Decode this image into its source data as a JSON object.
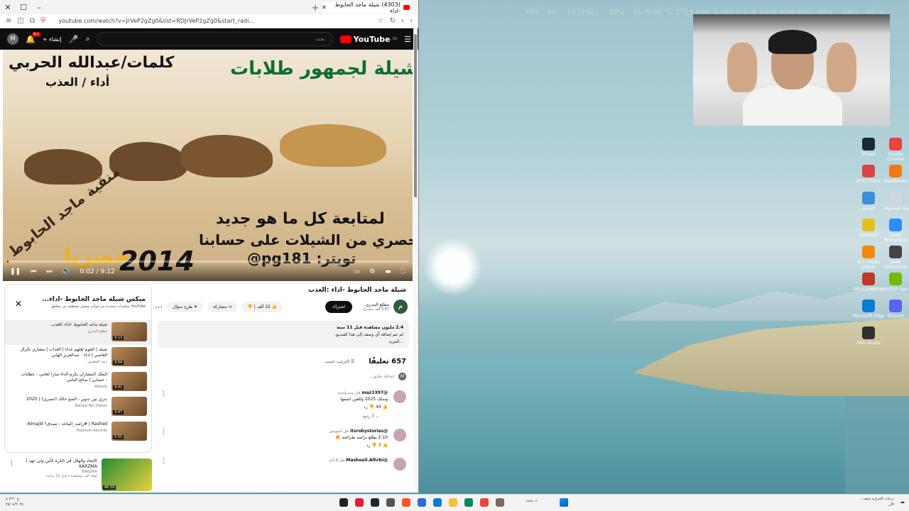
{
  "osd": {
    "fps_label": "FPS",
    "fps": "61",
    "lows": "18 (1%L)",
    "gpu_label": "GPU",
    "gpu": "91 % 66 °C 2715 MHz 1.065 V 0 W 1009 RPM 8501 MHz",
    "cpu_label": "CPU",
    "cpu": "48 %",
    "lat_label": "LAT",
    "lat": "11.8 ms"
  },
  "desktop_icons": [
    {
      "label": "Steam",
      "color": "#1b2838"
    },
    {
      "label": "Google Chrome",
      "color": "#e8453c"
    },
    {
      "label": "OCCT Plaza",
      "color": "#d84545"
    },
    {
      "label": "SteelSeries",
      "color": "#f07a1a"
    },
    {
      "label": "الشاشة",
      "color": "#3c8fd6"
    },
    {
      "label": "سلة المحذوفات",
      "color": "#cfd6dd"
    },
    {
      "label": "Overwolf",
      "color": "#e0c020"
    },
    {
      "label": "Zoom Workplace",
      "color": "#2d8cff"
    },
    {
      "label": "VLC media player",
      "color": "#f08a0a"
    },
    {
      "label": "Geek Uninstaller",
      "color": "#444"
    },
    {
      "label": "Win11Debloat",
      "color": "#c0392b"
    },
    {
      "label": "NVIDIA App",
      "color": "#76b900"
    },
    {
      "label": "Microsoft Edge",
      "color": "#0c7cd5"
    },
    {
      "label": "Discord",
      "color": "#5865f2"
    },
    {
      "label": "OBS Studio",
      "color": "#303030"
    }
  ],
  "browser": {
    "tab_title": "(4303) شيلة ماجد الحابوط -اداء",
    "url": "youtube.com/watch?v=JrVeP2gZg0&list=RDJrVeP2gZg0&start_radi..."
  },
  "youtube": {
    "logo": "YouTube",
    "logo_region": "SA",
    "create_label": "إنشاء",
    "notif_count": "9+",
    "avatar_letter": "M",
    "search_placeholder": "بحث"
  },
  "video": {
    "overlay_top_right": "شيلة لجمهور طلابات",
    "overlay_top_left1": "كلمات/عبدالله الحربي",
    "overlay_top_left2": "أداء / العذب",
    "overlay_mid1": "لمتابعة كل ما هو جديد",
    "overlay_mid2": "وحصري من الشيلات على حسابنا",
    "overlay_twitter": "تويتر: pg181@",
    "overlay_year": "2014",
    "overlay_excl": "حصريا",
    "overlay_diag": "منقية ماجد الحابوط",
    "time": "0:02 / 9:12",
    "progress_pct": 0.4
  },
  "info": {
    "title": "شيلة ماجد الحابوط -اداء :العذب",
    "channel_name": "مطلع البندري",
    "channel_subs": "3.87 ألف مشترك",
    "channel_initial": "م",
    "subscribe": "اشتراك",
    "likes": "22 ألف",
    "share": "مشاركة",
    "more_action": "طرح سؤال",
    "views": "2.4 مليون مشاهدة قبل 11 سنة",
    "desc_line": "لم تتم إضافة أي وصف إلى هذا الفيديو.",
    "desc_more": "...المزيد",
    "comment_count": "657 تعليقًا",
    "sort_label": "الترتيب حسب",
    "add_comment": "إضافة تعليق..."
  },
  "comments": [
    {
      "user": "@maz3397",
      "age": "قبل سنة واحدة",
      "text": "وسلك 2025 وللعين اسمها",
      "likes": "49",
      "reply": "رد",
      "replies": "3 ردود"
    },
    {
      "user": "@itsrobystories",
      "age": "قبل أسبوعين",
      "text": "2:10 يطلع براسه طرائحه 🔥",
      "likes": "3",
      "reply": "رد",
      "replies": ""
    },
    {
      "user": "@Masheail.Alhrbi",
      "age": "قبل 8 أيام",
      "text": "",
      "likes": "",
      "reply": "",
      "replies": ""
    }
  ],
  "playlist": {
    "title": "ميكس شيلة ماجد الحابوط -اداء...",
    "subtitle": "YouTube ميكسات متجددة من قوائم تشغيل مقتطفة من مقاطع",
    "items": [
      {
        "title": "شيلة ماجد الحابوط -اداء :العذب",
        "channel": "مطلع البندري",
        "duration": "9:13",
        "active": true
      },
      {
        "title": "شيله | القوم لعلهم غداء | العذاب | مشاري بالزال العاصي | اداء : عبدالعزيز الهاني",
        "channel": "ديفة العطيوي",
        "duration": "4:04",
        "active": false
      },
      {
        "title": "الملك المشاران بكرم الداء سارا لعامي - عظايات - حسابي | صالح اليامي",
        "channel": "Alwash",
        "duration": "4:41",
        "active": false
      },
      {
        "title": "بدري نين تدوير - الضو حالك (حصري) | 2020",
        "channel": "Bandar Bin Oweer",
        "duration": "3:47",
        "active": false
      },
      {
        "title": "Rashed | #راشد_الماجد - تصدق؟ Almajid",
        "channel": "Platinum Records",
        "duration": "5:55",
        "active": false
      }
    ]
  },
  "next_video": {
    "title": "الإتحاد والهلال في الكرة كأس ولي عهد | KARZMA",
    "channel": "KARZMA",
    "meta": "إتقاد الف مشاهدة • قبل 13 ساعة",
    "duration": "48:39"
  },
  "taskbar": {
    "search": "بحث",
    "weather": "درجات الحرارة تنخف...",
    "weather_sub": "الآن",
    "tray_line1": "ع ٥:٢٠ م",
    "tray_line2": "٢٥/٠٤/٢٠٢٥"
  }
}
